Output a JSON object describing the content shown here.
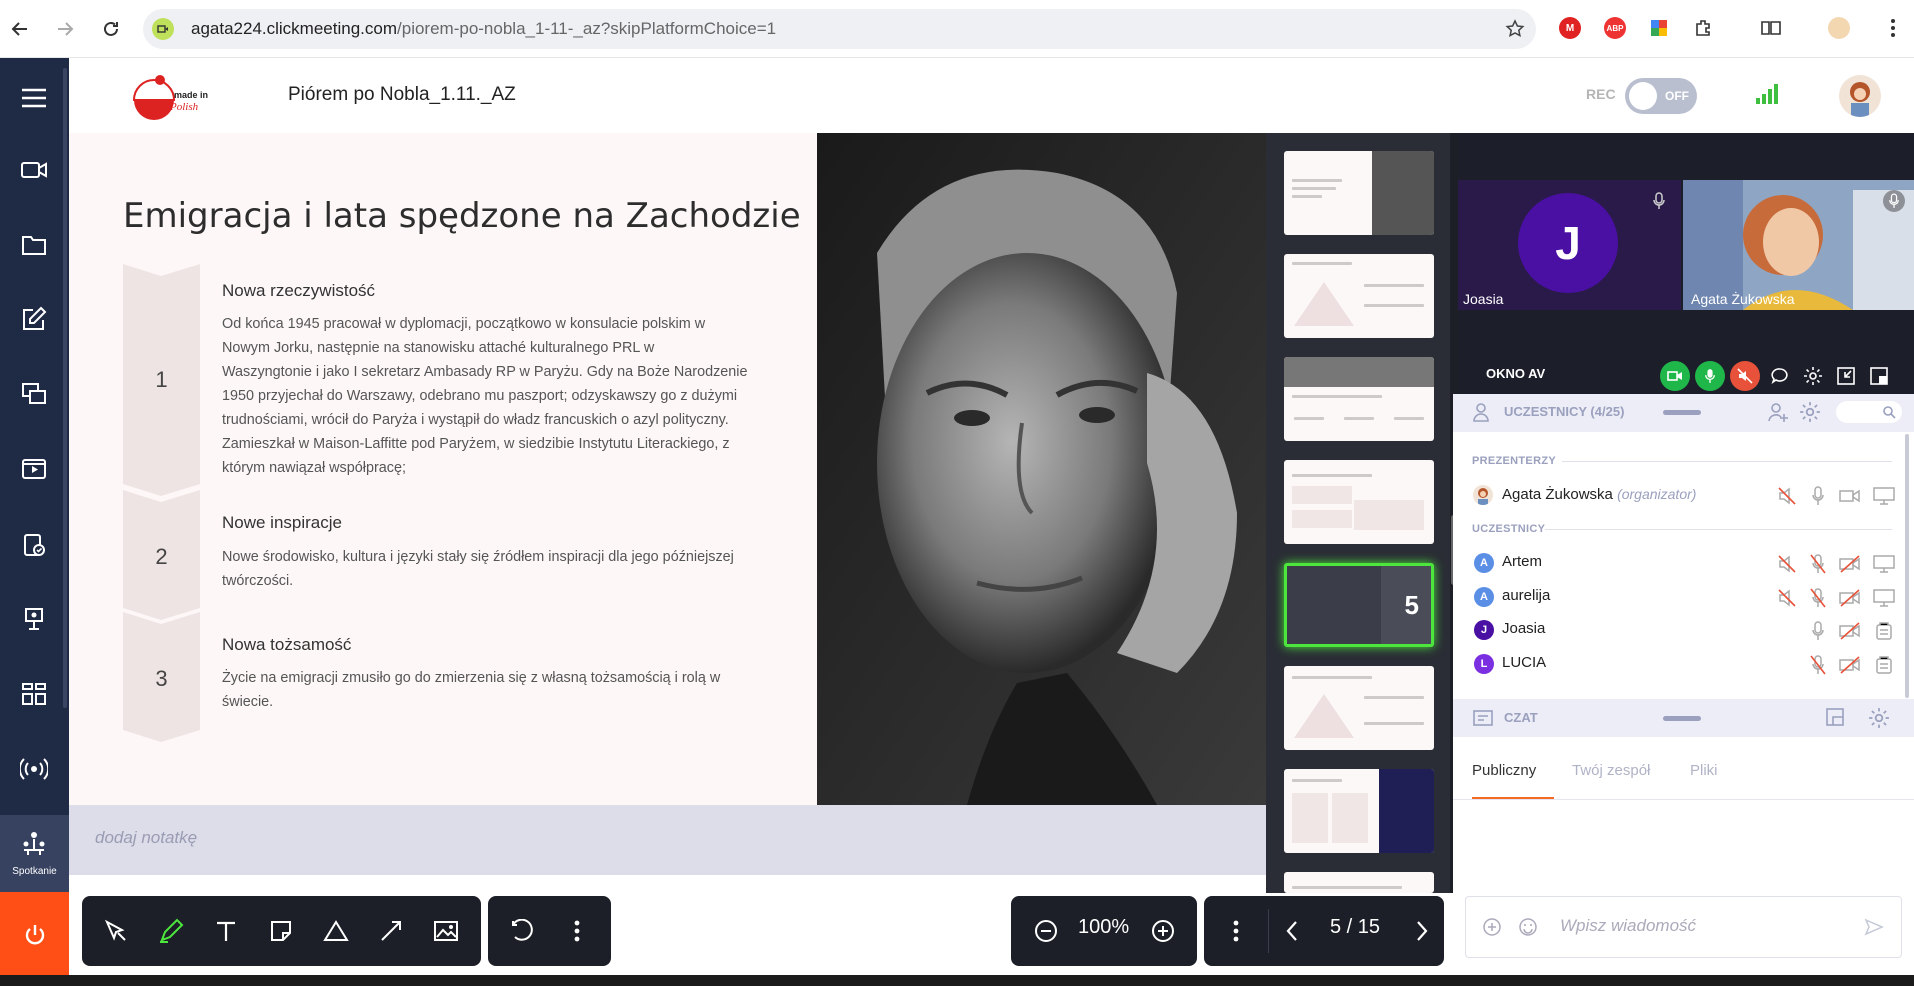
{
  "browser": {
    "url_host": "agata224.clickmeeting.com",
    "url_path": "/piorem-po-nobla_1-11-_az?skipPlatformChoice=1",
    "ext_abp": "ABP"
  },
  "header": {
    "room_title": "Piórem po Nobla_1.11._AZ",
    "rec_label": "REC",
    "rec_toggle": "OFF"
  },
  "rail": {
    "active_label": "Spotkanie"
  },
  "slide": {
    "title": "Emigracja i lata spędzone na Zachodzie",
    "items": [
      {
        "num": "1",
        "heading": "Nowa rzeczywistość",
        "lines": [
          "Od końca 1945 pracował w dyplomacji, początkowo w konsulacie polskim w",
          "Nowym Jorku, następnie na stanowisku attaché kulturalnego PRL w",
          "Waszyngtonie i jako I sekretarz Ambasady RP w Paryżu. Gdy na Boże Narodzenie",
          "1950 przyjechał do Warszawy, odebrano mu paszport; odzyskawszy go z dużymi",
          "trudnościami, wrócił do Paryża i wystąpił do władz francuskich o azyl polityczny.",
          "Zamieszkał w Maison-Laffitte pod Paryżem, w siedzibie Instytutu Literackiego, z",
          "którym nawiązał współpracę;"
        ]
      },
      {
        "num": "2",
        "heading": "Nowe inspiracje",
        "lines": [
          "Nowe środowisko, kultura i języki stały się źródłem inspiracji dla jego późniejszej",
          "twórczości."
        ]
      },
      {
        "num": "3",
        "heading": "Nowa tożsamość",
        "lines": [
          "Życie na emigracji zmusiło go do zmierzenia się z własną tożsamością i rolą w",
          "świecie."
        ]
      }
    ],
    "note_placeholder": "dodaj notatkę"
  },
  "thumbnails": {
    "selected_number": "5"
  },
  "toolbar": {
    "zoom": "100%",
    "page": "5 / 15"
  },
  "video": {
    "tile1_initial": "J",
    "tile1_name": "Joasia",
    "tile2_name": "Agata Żukowska",
    "panel_title": "OKNO AV"
  },
  "participants": {
    "title": "UCZESTNICY (4/25)",
    "presenters_label": "PREZENTERZY",
    "attendees_label": "UCZESTNICY",
    "presenter": {
      "name": "Agata Żukowska",
      "role": "(organizator)"
    },
    "attendees": [
      {
        "initial": "A",
        "name": "Artem",
        "color": "#5b8fe6"
      },
      {
        "initial": "A",
        "name": "aurelija",
        "color": "#5b8fe6"
      },
      {
        "initial": "J",
        "name": "Joasia",
        "color": "#4a0fa3"
      },
      {
        "initial": "L",
        "name": "LUCIA",
        "color": "#7a2fe0"
      }
    ]
  },
  "chat": {
    "title": "CZAT",
    "tabs": [
      "Publiczny",
      "Twój zespół",
      "Pliki"
    ],
    "input_placeholder": "Wpisz wiadomość"
  },
  "colors": {
    "rail": "#1f2a44",
    "accent_orange": "#ff4f17",
    "active_green": "#4ce63c",
    "video_green": "#20b74a",
    "muted_red": "#e8523a"
  }
}
